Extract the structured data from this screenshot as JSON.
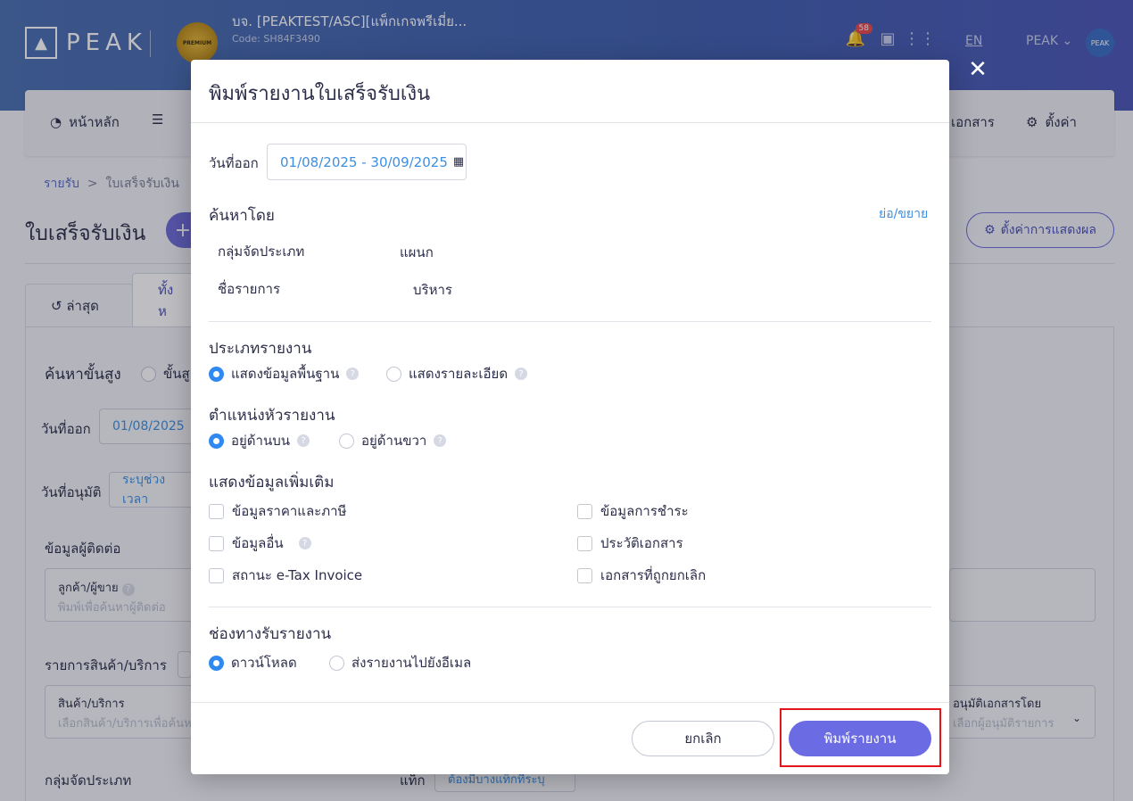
{
  "app": {
    "logo_text": "PEAK",
    "company_name": "บจ. [PEAKTEST/ASC][แพ็กเกจพรีเมี่ย...",
    "company_code": "Code: SH84F3490",
    "premium_badge": "PREMIUM",
    "notification_count": "58",
    "language": "EN",
    "user_label": "PEAK",
    "avatar_text": "PEAK"
  },
  "nav": {
    "home": "หน้าหลัก",
    "documents": "เอกสาร",
    "settings": "ตั้งค่า"
  },
  "breadcrumb": {
    "root": "รายรับ",
    "separator": ">",
    "current": "ใบเสร็จรับเงิน"
  },
  "page": {
    "title": "ใบเสร็จรับเงิน",
    "add_symbol": "+",
    "display_settings": "ตั้งค่าการแสดงผล",
    "tab_recent": "ล่าสุด",
    "tab_all": "ทั้งห"
  },
  "filters": {
    "advanced_search": "ค้นหาขั้นสูง",
    "advanced_option": "ขั้นสู",
    "issue_date_label": "วันที่ออก",
    "issue_date_value": "01/08/2025",
    "approve_date_label": "วันที่อนุมัติ",
    "approve_date_value": "ระบุช่วงเวลา",
    "contact_section": "ข้อมูลผู้ติดต่อ",
    "customer_label": "ลูกค้า/ผู้ขาย",
    "customer_placeholder": "พิมพ์เพื่อค้นหาผู้ติดต่อ",
    "product_section": "รายการสินค้า/บริการ",
    "product_label": "สินค้า/บริการ",
    "product_placeholder": "เลือกสินค้า/บริการเพื่อค้นห",
    "approver_label": "อนุมัติเอกสารโดย",
    "approver_placeholder": "เลือกผู้อนุมัติรายการ",
    "group_label": "กลุ่มจัดประเภท",
    "tag_label": "แท็ก",
    "tag_placeholder": "ต้องมีบางแท็กที่ระบุ"
  },
  "modal": {
    "title": "พิมพ์รายงานใบเสร็จรับเงิน",
    "close_symbol": "✕",
    "issue_date_label": "วันที่ออก",
    "date_range": "01/08/2025 - 30/09/2025",
    "search_by": {
      "heading": "ค้นหาโดย",
      "toggle": "ย่อ/ขยาย",
      "rows": [
        {
          "label": "กลุ่มจัดประเภท",
          "value": "แผนก"
        },
        {
          "label": "ชื่อรายการ",
          "value": "บริหาร"
        }
      ]
    },
    "report_type": {
      "heading": "ประเภทรายงาน",
      "options": [
        {
          "label": "แสดงข้อมูลพื้นฐาน",
          "selected": true
        },
        {
          "label": "แสดงรายละเอียด",
          "selected": false
        }
      ]
    },
    "header_position": {
      "heading": "ตำแหน่งหัวรายงาน",
      "options": [
        {
          "label": "อยู่ด้านบน",
          "selected": true
        },
        {
          "label": "อยู่ด้านขวา",
          "selected": false
        }
      ]
    },
    "extra_info": {
      "heading": "แสดงข้อมูลเพิ่มเติม",
      "options": [
        {
          "label": "ข้อมูลราคาและภาษี",
          "checked": false
        },
        {
          "label": "ข้อมูลการชำระ",
          "checked": false
        },
        {
          "label": "ข้อมูลอื่น",
          "checked": false
        },
        {
          "label": "ประวัติเอกสาร",
          "checked": false
        },
        {
          "label": "สถานะ e-Tax Invoice",
          "checked": false
        },
        {
          "label": "เอกสารที่ถูกยกเลิก",
          "checked": false
        }
      ]
    },
    "delivery": {
      "heading": "ช่องทางรับรายงาน",
      "options": [
        {
          "label": "ดาวน์โหลด",
          "selected": true
        },
        {
          "label": "ส่งรายงานไปยังอีเมล",
          "selected": false
        }
      ]
    },
    "cancel_label": "ยกเลิก",
    "print_label": "พิมพ์รายงาน",
    "help_symbol": "?"
  },
  "colors": {
    "accent": "#6b6be4",
    "link": "#3d8fe0",
    "radio_selected": "#2f89f0",
    "highlight": "#e4141b"
  }
}
